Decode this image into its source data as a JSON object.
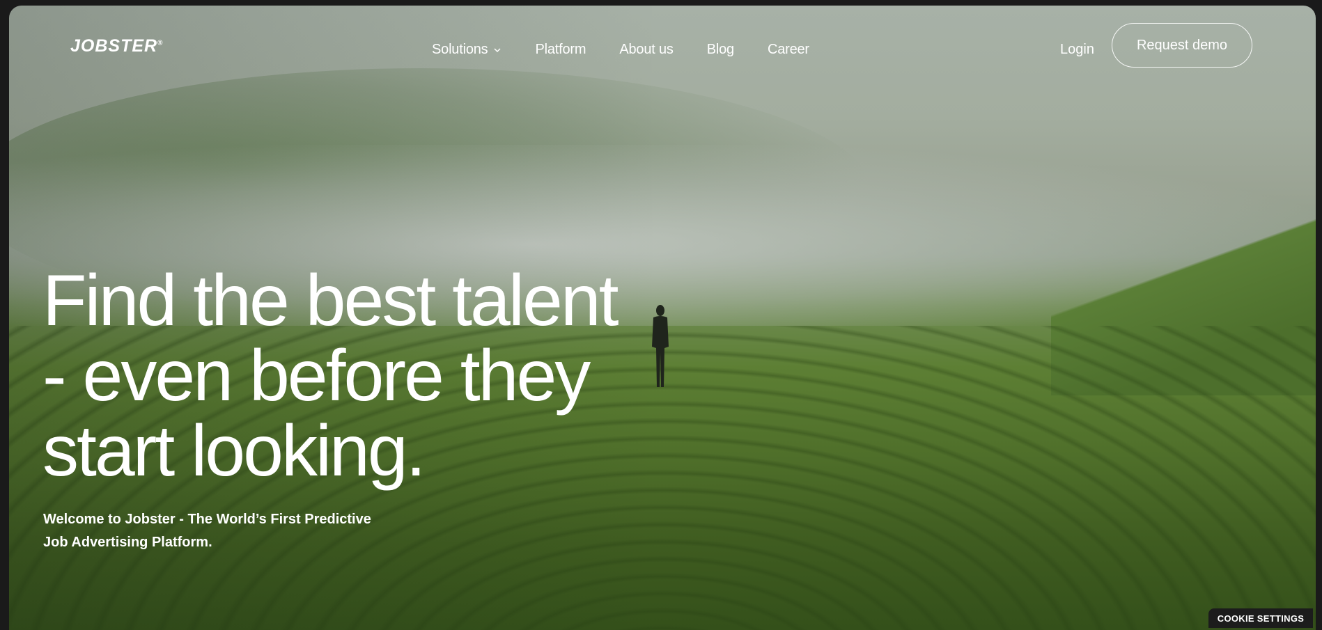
{
  "brand": {
    "logo_text": "JOBSTER",
    "logo_mark": "®"
  },
  "nav": {
    "items": [
      {
        "label": "Solutions",
        "has_dropdown": true
      },
      {
        "label": "Platform"
      },
      {
        "label": "About us"
      },
      {
        "label": "Blog"
      },
      {
        "label": "Career"
      }
    ],
    "login_label": "Login",
    "cta_label": "Request demo"
  },
  "hero": {
    "title_line_1": "Find the best talent",
    "title_line_2": "- even before they",
    "title_line_3": "start looking.",
    "subtitle_line_1": "Welcome to Jobster - The World’s First Predictive",
    "subtitle_line_2": "Job Advertising Platform."
  },
  "cookie": {
    "label": "COOKIE SETTINGS"
  },
  "icons": {
    "dropdown": "chevron-down-icon"
  },
  "colors": {
    "text": "#ffffff",
    "cookie_bg": "#1c1c1c"
  }
}
